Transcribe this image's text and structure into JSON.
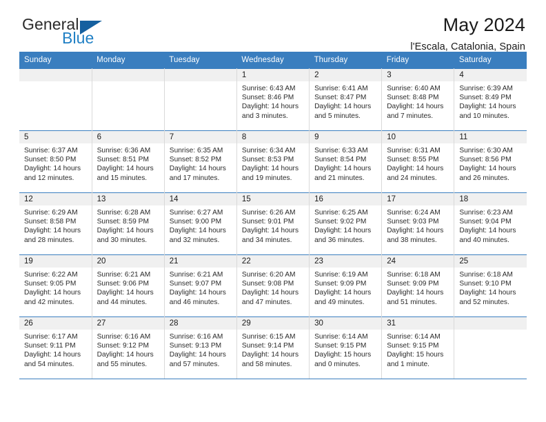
{
  "branding": {
    "logo_primary": "General",
    "logo_secondary": "Blue",
    "logo_triangle_color": "#15609f",
    "logo_secondary_color": "#1f7fc4"
  },
  "header": {
    "title": "May 2024",
    "subtitle": "l'Escala, Catalonia, Spain"
  },
  "theme": {
    "header_bar_color": "#3a7ebf",
    "daynum_band_color": "#f0f0f0",
    "grid_line_color": "#d9d9d9"
  },
  "calendar": {
    "weekday_headers": [
      "Sunday",
      "Monday",
      "Tuesday",
      "Wednesday",
      "Thursday",
      "Friday",
      "Saturday"
    ],
    "weeks": [
      [
        {
          "day": "",
          "sunrise": "",
          "sunset": "",
          "daylight": ""
        },
        {
          "day": "",
          "sunrise": "",
          "sunset": "",
          "daylight": ""
        },
        {
          "day": "",
          "sunrise": "",
          "sunset": "",
          "daylight": ""
        },
        {
          "day": "1",
          "sunrise": "Sunrise: 6:43 AM",
          "sunset": "Sunset: 8:46 PM",
          "daylight": "Daylight: 14 hours and 3 minutes."
        },
        {
          "day": "2",
          "sunrise": "Sunrise: 6:41 AM",
          "sunset": "Sunset: 8:47 PM",
          "daylight": "Daylight: 14 hours and 5 minutes."
        },
        {
          "day": "3",
          "sunrise": "Sunrise: 6:40 AM",
          "sunset": "Sunset: 8:48 PM",
          "daylight": "Daylight: 14 hours and 7 minutes."
        },
        {
          "day": "4",
          "sunrise": "Sunrise: 6:39 AM",
          "sunset": "Sunset: 8:49 PM",
          "daylight": "Daylight: 14 hours and 10 minutes."
        }
      ],
      [
        {
          "day": "5",
          "sunrise": "Sunrise: 6:37 AM",
          "sunset": "Sunset: 8:50 PM",
          "daylight": "Daylight: 14 hours and 12 minutes."
        },
        {
          "day": "6",
          "sunrise": "Sunrise: 6:36 AM",
          "sunset": "Sunset: 8:51 PM",
          "daylight": "Daylight: 14 hours and 15 minutes."
        },
        {
          "day": "7",
          "sunrise": "Sunrise: 6:35 AM",
          "sunset": "Sunset: 8:52 PM",
          "daylight": "Daylight: 14 hours and 17 minutes."
        },
        {
          "day": "8",
          "sunrise": "Sunrise: 6:34 AM",
          "sunset": "Sunset: 8:53 PM",
          "daylight": "Daylight: 14 hours and 19 minutes."
        },
        {
          "day": "9",
          "sunrise": "Sunrise: 6:33 AM",
          "sunset": "Sunset: 8:54 PM",
          "daylight": "Daylight: 14 hours and 21 minutes."
        },
        {
          "day": "10",
          "sunrise": "Sunrise: 6:31 AM",
          "sunset": "Sunset: 8:55 PM",
          "daylight": "Daylight: 14 hours and 24 minutes."
        },
        {
          "day": "11",
          "sunrise": "Sunrise: 6:30 AM",
          "sunset": "Sunset: 8:56 PM",
          "daylight": "Daylight: 14 hours and 26 minutes."
        }
      ],
      [
        {
          "day": "12",
          "sunrise": "Sunrise: 6:29 AM",
          "sunset": "Sunset: 8:58 PM",
          "daylight": "Daylight: 14 hours and 28 minutes."
        },
        {
          "day": "13",
          "sunrise": "Sunrise: 6:28 AM",
          "sunset": "Sunset: 8:59 PM",
          "daylight": "Daylight: 14 hours and 30 minutes."
        },
        {
          "day": "14",
          "sunrise": "Sunrise: 6:27 AM",
          "sunset": "Sunset: 9:00 PM",
          "daylight": "Daylight: 14 hours and 32 minutes."
        },
        {
          "day": "15",
          "sunrise": "Sunrise: 6:26 AM",
          "sunset": "Sunset: 9:01 PM",
          "daylight": "Daylight: 14 hours and 34 minutes."
        },
        {
          "day": "16",
          "sunrise": "Sunrise: 6:25 AM",
          "sunset": "Sunset: 9:02 PM",
          "daylight": "Daylight: 14 hours and 36 minutes."
        },
        {
          "day": "17",
          "sunrise": "Sunrise: 6:24 AM",
          "sunset": "Sunset: 9:03 PM",
          "daylight": "Daylight: 14 hours and 38 minutes."
        },
        {
          "day": "18",
          "sunrise": "Sunrise: 6:23 AM",
          "sunset": "Sunset: 9:04 PM",
          "daylight": "Daylight: 14 hours and 40 minutes."
        }
      ],
      [
        {
          "day": "19",
          "sunrise": "Sunrise: 6:22 AM",
          "sunset": "Sunset: 9:05 PM",
          "daylight": "Daylight: 14 hours and 42 minutes."
        },
        {
          "day": "20",
          "sunrise": "Sunrise: 6:21 AM",
          "sunset": "Sunset: 9:06 PM",
          "daylight": "Daylight: 14 hours and 44 minutes."
        },
        {
          "day": "21",
          "sunrise": "Sunrise: 6:21 AM",
          "sunset": "Sunset: 9:07 PM",
          "daylight": "Daylight: 14 hours and 46 minutes."
        },
        {
          "day": "22",
          "sunrise": "Sunrise: 6:20 AM",
          "sunset": "Sunset: 9:08 PM",
          "daylight": "Daylight: 14 hours and 47 minutes."
        },
        {
          "day": "23",
          "sunrise": "Sunrise: 6:19 AM",
          "sunset": "Sunset: 9:09 PM",
          "daylight": "Daylight: 14 hours and 49 minutes."
        },
        {
          "day": "24",
          "sunrise": "Sunrise: 6:18 AM",
          "sunset": "Sunset: 9:09 PM",
          "daylight": "Daylight: 14 hours and 51 minutes."
        },
        {
          "day": "25",
          "sunrise": "Sunrise: 6:18 AM",
          "sunset": "Sunset: 9:10 PM",
          "daylight": "Daylight: 14 hours and 52 minutes."
        }
      ],
      [
        {
          "day": "26",
          "sunrise": "Sunrise: 6:17 AM",
          "sunset": "Sunset: 9:11 PM",
          "daylight": "Daylight: 14 hours and 54 minutes."
        },
        {
          "day": "27",
          "sunrise": "Sunrise: 6:16 AM",
          "sunset": "Sunset: 9:12 PM",
          "daylight": "Daylight: 14 hours and 55 minutes."
        },
        {
          "day": "28",
          "sunrise": "Sunrise: 6:16 AM",
          "sunset": "Sunset: 9:13 PM",
          "daylight": "Daylight: 14 hours and 57 minutes."
        },
        {
          "day": "29",
          "sunrise": "Sunrise: 6:15 AM",
          "sunset": "Sunset: 9:14 PM",
          "daylight": "Daylight: 14 hours and 58 minutes."
        },
        {
          "day": "30",
          "sunrise": "Sunrise: 6:14 AM",
          "sunset": "Sunset: 9:15 PM",
          "daylight": "Daylight: 15 hours and 0 minutes."
        },
        {
          "day": "31",
          "sunrise": "Sunrise: 6:14 AM",
          "sunset": "Sunset: 9:15 PM",
          "daylight": "Daylight: 15 hours and 1 minute."
        },
        {
          "day": "",
          "sunrise": "",
          "sunset": "",
          "daylight": ""
        }
      ]
    ]
  }
}
